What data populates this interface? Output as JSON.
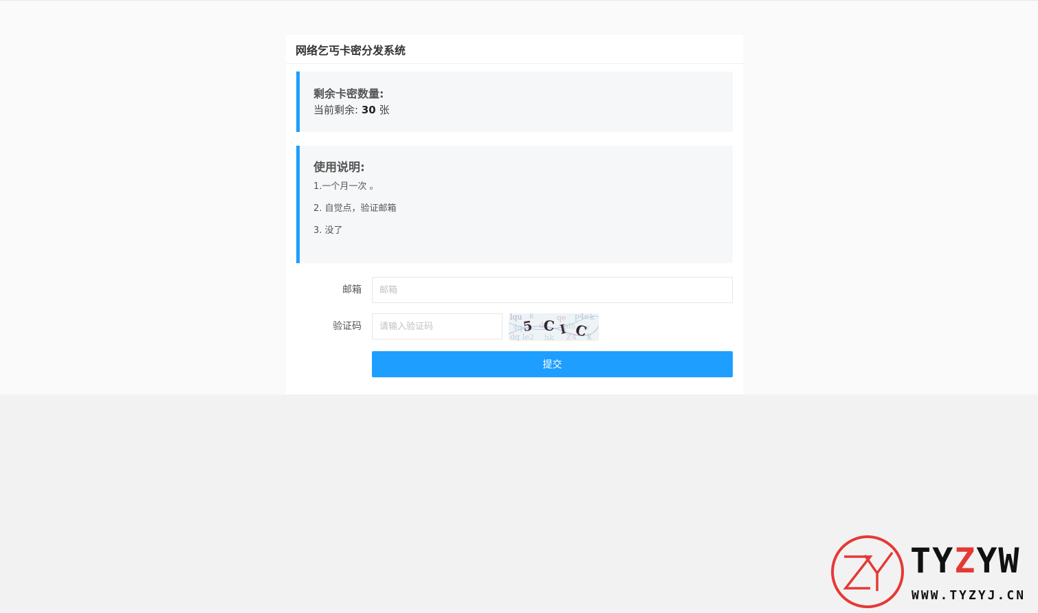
{
  "card": {
    "title": "网络乞丐卡密分发系统"
  },
  "stock": {
    "title": "剩余卡密数量:",
    "prefix": "当前剩余:",
    "count": "30",
    "unit": "张"
  },
  "usage": {
    "title": "使用说明:",
    "items": [
      "1.一个月一次 。",
      "2. 自觉点，验证邮箱",
      "3. 没了"
    ]
  },
  "form": {
    "email_label": "邮箱",
    "email_placeholder": "邮箱",
    "email_value": "",
    "captcha_label": "验证码",
    "captcha_placeholder": "请输入验证码",
    "captcha_value": "",
    "captcha_text": "5CIC",
    "submit_label": "提交"
  },
  "watermark": {
    "logo_text": "ZY",
    "brand_a": "TY",
    "brand_b": "Z",
    "brand_c": "YW",
    "url": "WWW.TYZYJ.CN",
    "colors": {
      "red": "#e53935",
      "dark": "#111111"
    }
  },
  "colors": {
    "accent": "#1e9fff",
    "quote_bg": "#f6f7f8"
  }
}
